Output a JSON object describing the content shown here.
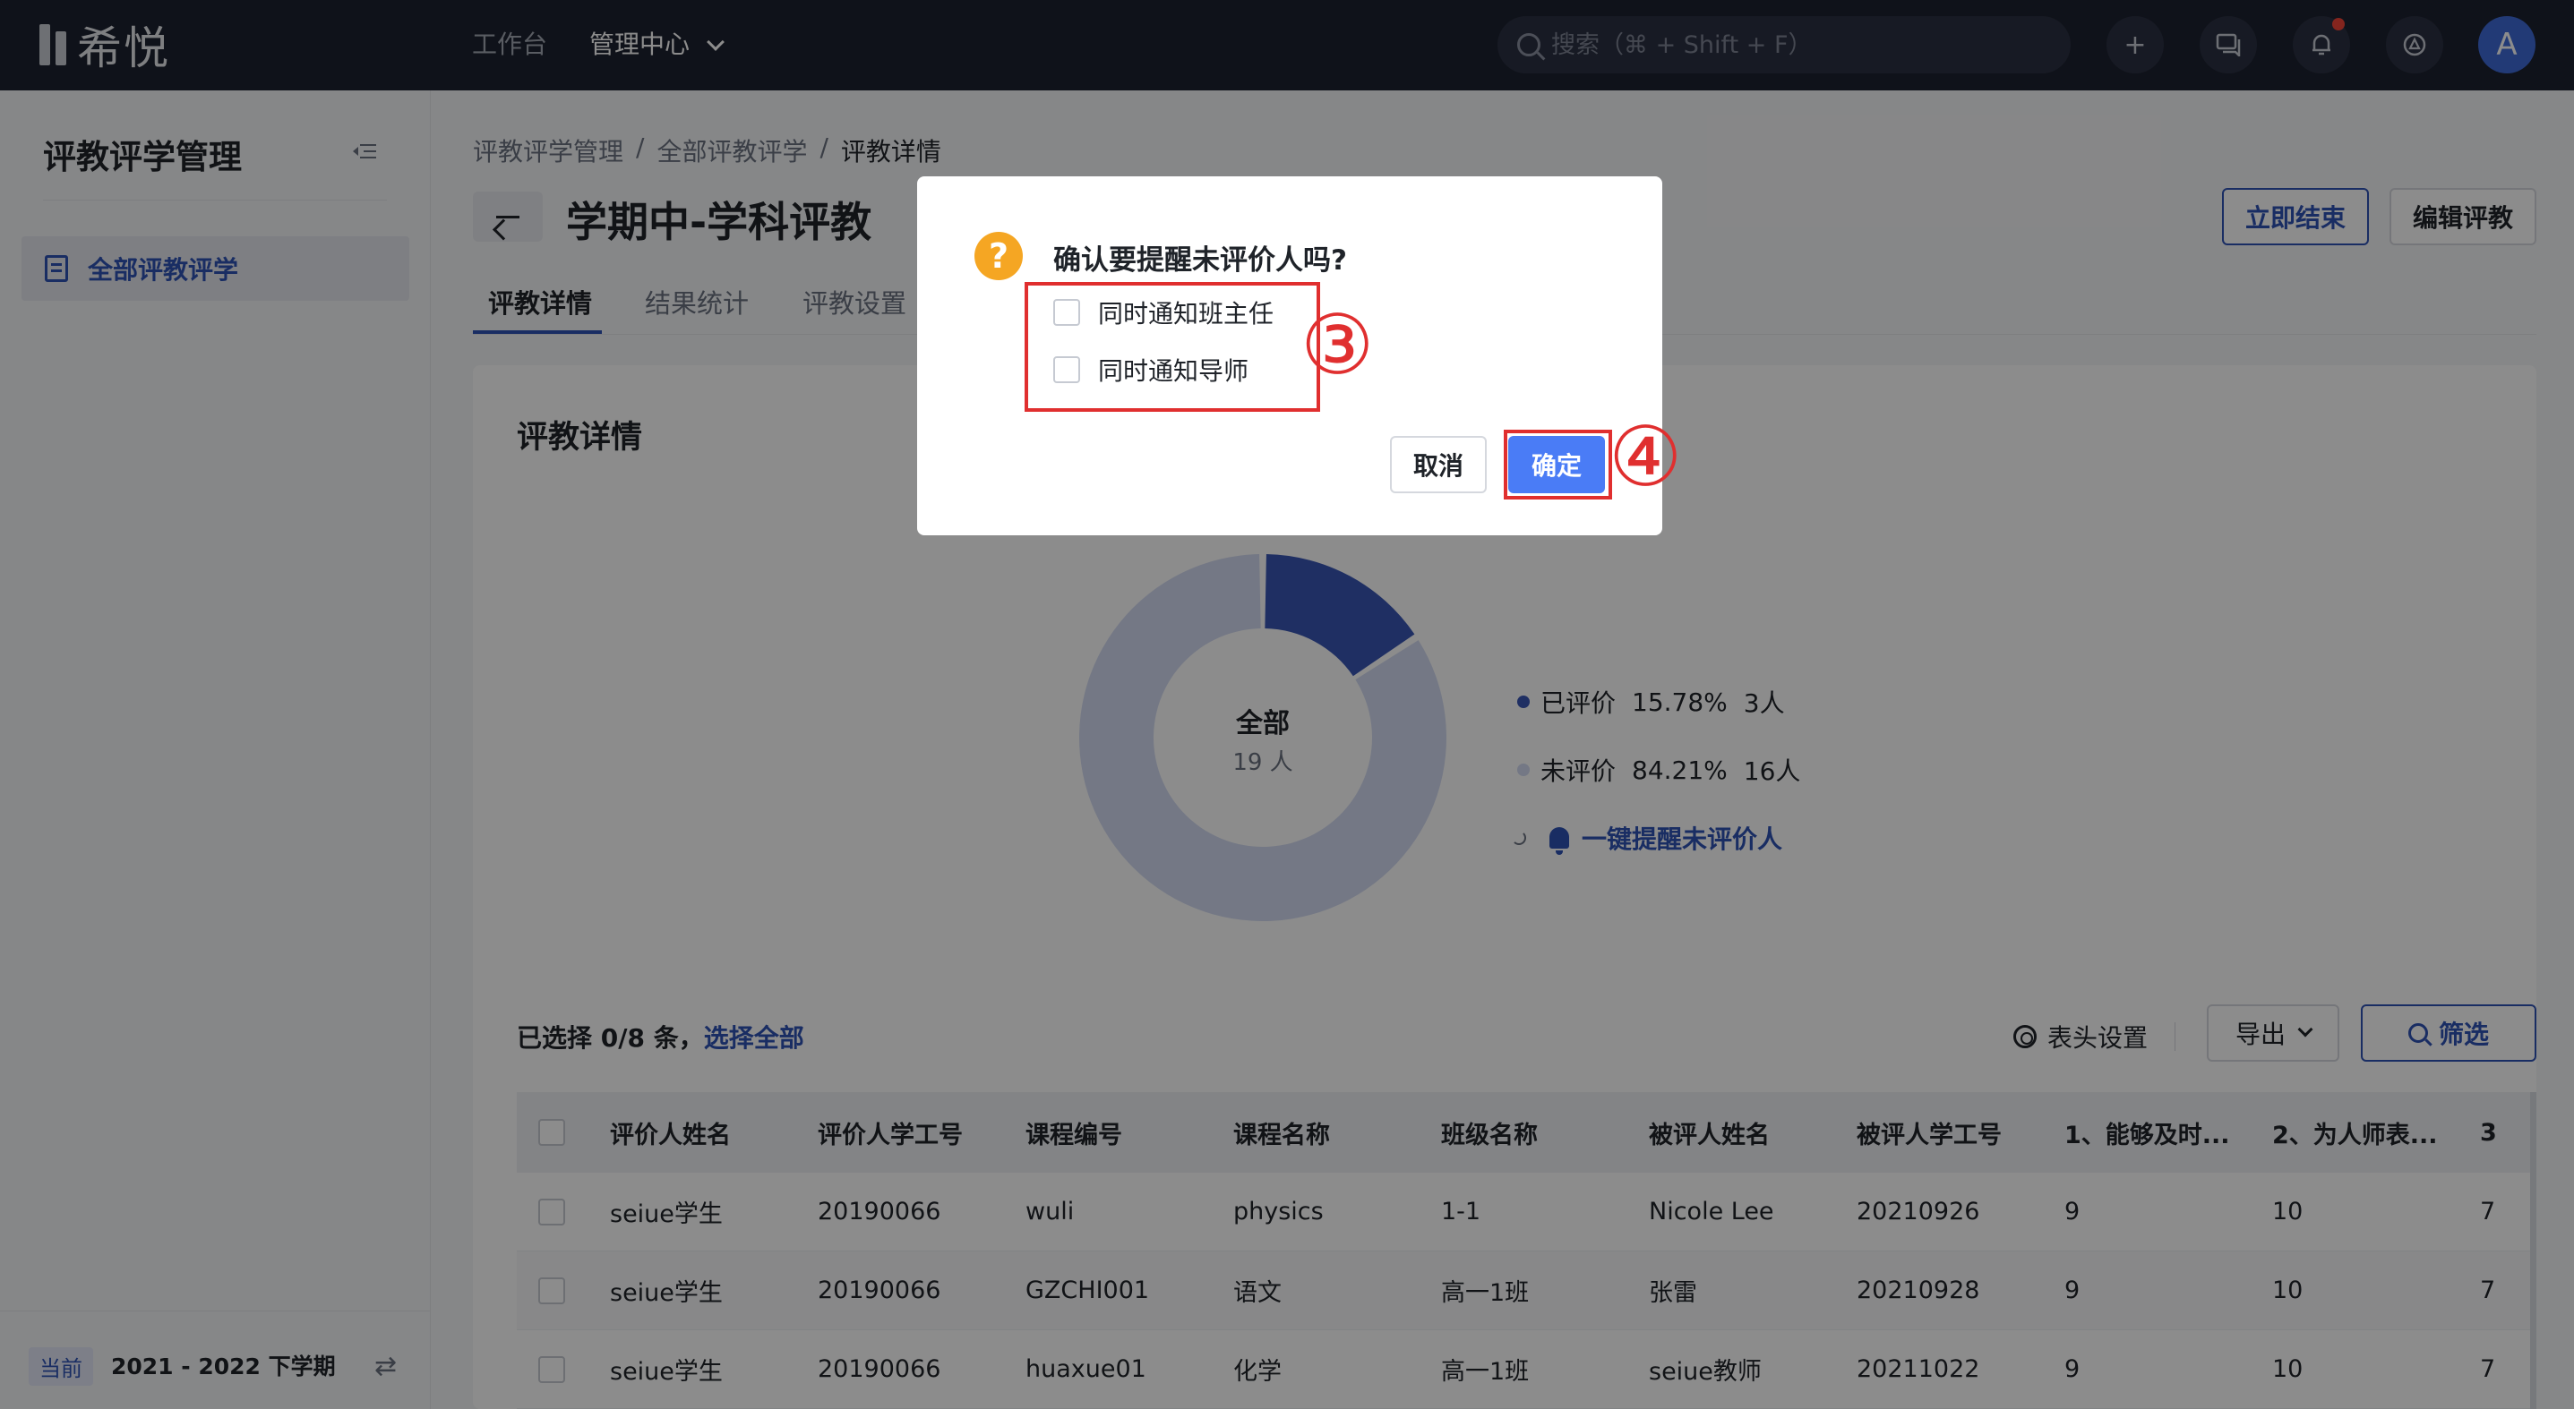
{
  "topbar": {
    "logo_text": "希悦",
    "nav": [
      "工作台",
      "管理中心"
    ],
    "search_placeholder": "搜索（⌘ + Shift + F）",
    "avatar_letter": "A"
  },
  "sidebar": {
    "title": "评教评学管理",
    "items": [
      {
        "label": "全部评教评学"
      }
    ],
    "term_badge": "当前",
    "term": "2021 - 2022 下学期"
  },
  "breadcrumb": [
    "评教评学管理",
    "/",
    "全部评教评学",
    "/",
    "评教详情"
  ],
  "page": {
    "title": "学期中-学科评教",
    "end_button": "立即结束",
    "edit_button": "编辑评教",
    "tabs": [
      "评教详情",
      "结果统计",
      "评教设置"
    ]
  },
  "card": {
    "title": "评教详情",
    "donut_center_title": "全部",
    "donut_center_sub": "19 人",
    "legend": [
      {
        "label": "已评价",
        "pct": "15.78%",
        "count": "3人",
        "color": "#3a57b5"
      },
      {
        "label": "未评价",
        "pct": "84.21%",
        "count": "16人",
        "color": "#d3dbf2"
      }
    ],
    "remind_label": "一键提醒未评价人",
    "selection_prefix": "已选择 0/8 条，",
    "select_all": "选择全部",
    "header_settings": "表头设置",
    "export": "导出",
    "filter": "筛选"
  },
  "chart_data": {
    "type": "pie",
    "categories": [
      "已评价",
      "未评价"
    ],
    "values": [
      15.78,
      84.21
    ],
    "counts": [
      3,
      16
    ],
    "total": 19
  },
  "table": {
    "columns": [
      "评价人姓名",
      "评价人学工号",
      "课程编号",
      "课程名称",
      "班级名称",
      "被评人姓名",
      "被评人学工号",
      "1、能够及时...",
      "2、为人师表...",
      "3"
    ],
    "rows": [
      [
        "seiue学生",
        "20190066",
        "wuli",
        "physics",
        "1-1",
        "Nicole Lee",
        "20210926",
        "9",
        "10",
        "7"
      ],
      [
        "seiue学生",
        "20190066",
        "GZCHI001",
        "语文",
        "高一1班",
        "张雷",
        "20210928",
        "9",
        "10",
        "7"
      ],
      [
        "seiue学生",
        "20190066",
        "huaxue01",
        "化学",
        "高一1班",
        "seiue教师",
        "20211022",
        "9",
        "10",
        "7"
      ]
    ]
  },
  "dialog": {
    "title": "确认要提醒未评价人吗?",
    "options": [
      "同时通知班主任",
      "同时通知导师"
    ],
    "cancel": "取消",
    "confirm": "确定",
    "annotations": [
      "③",
      "④"
    ],
    "highlight_color": "#e02f2f"
  }
}
